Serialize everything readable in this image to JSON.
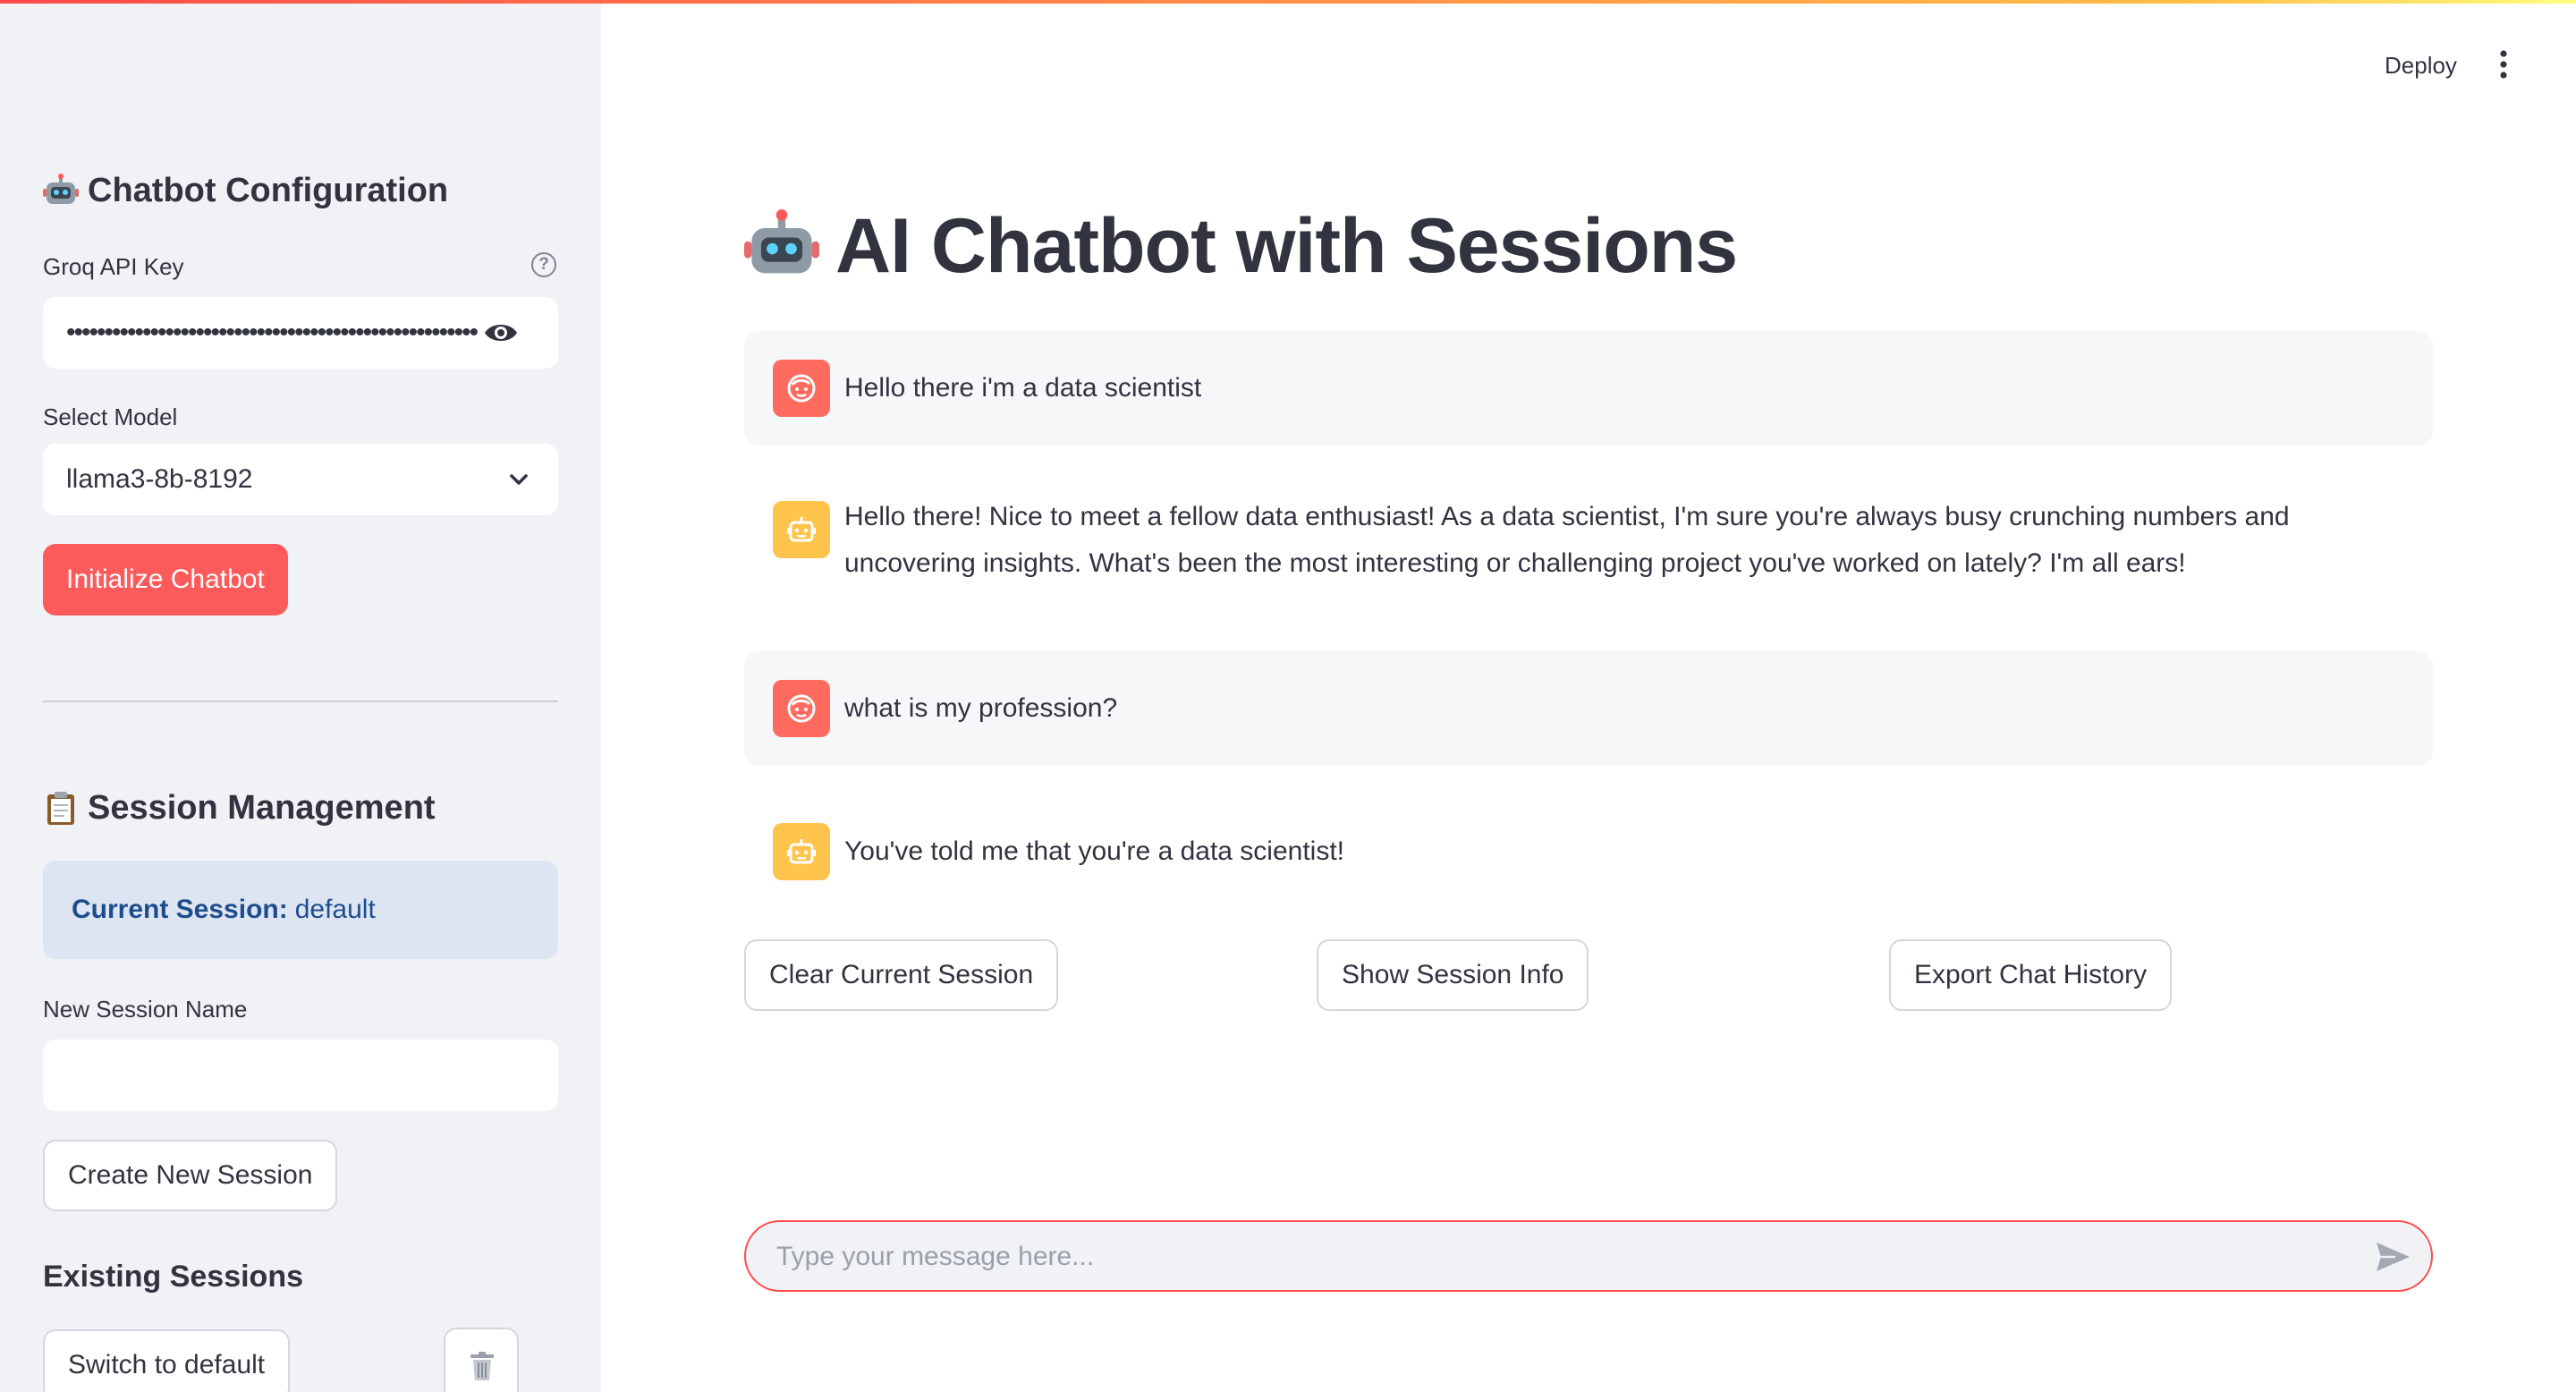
{
  "sidebar": {
    "config_title": "Chatbot Configuration",
    "api_key_label": "Groq API Key",
    "api_key_value": "••••••••••••••••••••••••••••••••••••••••••••••••••••••",
    "model_label": "Select Model",
    "model_selected": "llama3-8b-8192",
    "init_button": "Initialize Chatbot",
    "session_title": "Session Management",
    "current_session_label": "Current Session:",
    "current_session_value": "default",
    "new_session_label": "New Session Name",
    "new_session_value": "",
    "create_button": "Create New Session",
    "existing_title": "Existing Sessions",
    "switch_button": "Switch to default"
  },
  "header": {
    "deploy_label": "Deploy"
  },
  "main": {
    "title": "AI Chatbot with Sessions",
    "messages": [
      {
        "role": "user",
        "text": "Hello there i'm a data scientist"
      },
      {
        "role": "assistant",
        "text": "Hello there! Nice to meet a fellow data enthusiast! As a data scientist, I'm sure you're always busy crunching numbers and uncovering insights. What's been the most interesting or challenging project you've worked on lately? I'm all ears!"
      },
      {
        "role": "user",
        "text": "what is my profession?"
      },
      {
        "role": "assistant",
        "text": "You've told me that you're a data scientist!"
      }
    ],
    "buttons": {
      "clear": "Clear Current Session",
      "info": "Show Session Info",
      "export": "Export Chat History"
    },
    "chat_input_placeholder": "Type your message here..."
  },
  "colors": {
    "primary": "#ff4b4b",
    "sidebar_bg": "#f0f2f6",
    "info_bg": "#dde5f2",
    "info_text": "#1d4d8d",
    "user_avatar": "#ff6b5f",
    "assistant_avatar": "#ffc44c"
  },
  "icons": {
    "config_title": "robot-icon",
    "session_title": "clipboard-icon",
    "page_title": "robot-icon",
    "help": "question-circle-icon",
    "password_toggle": "eye-icon",
    "select": "chevron-down-icon",
    "delete": "trash-icon",
    "menu": "kebab-menu-icon",
    "send": "send-icon"
  }
}
